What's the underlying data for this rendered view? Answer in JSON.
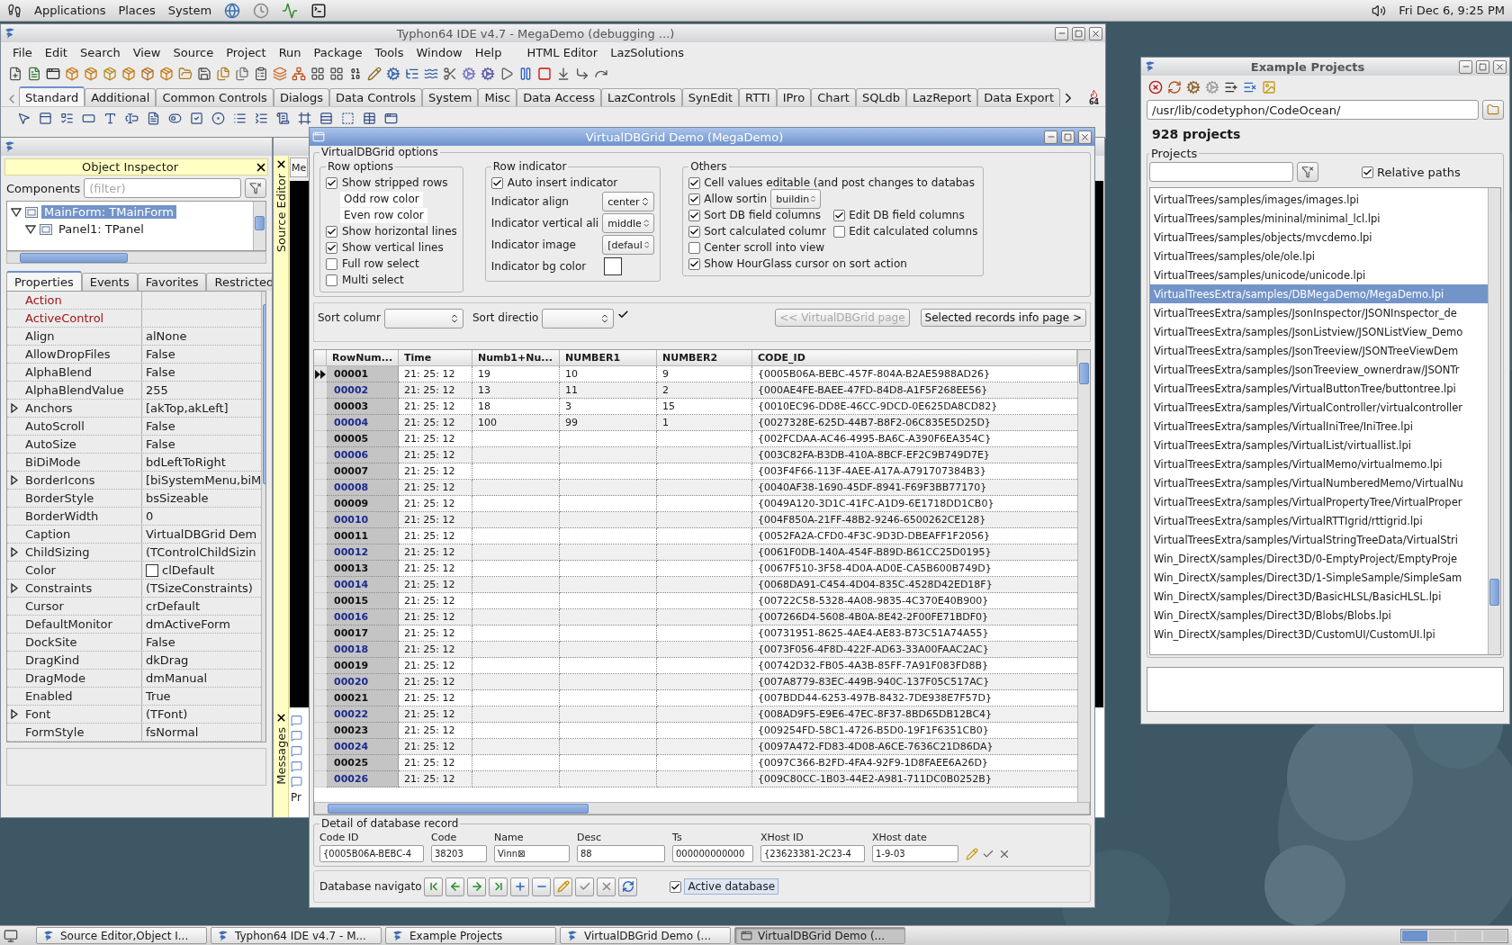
{
  "top_panel": {
    "menus": [
      "Applications",
      "Places",
      "System"
    ],
    "clock": "Fri Dec 6, 9:25 PM"
  },
  "ide": {
    "title": "Typhon64 IDE v4.7 - MegaDemo (debugging ...)",
    "menu": [
      "File",
      "Edit",
      "Search",
      "View",
      "Source",
      "Project",
      "Run",
      "Package",
      "Tools",
      "Window",
      "Help",
      "HTML Editor",
      "LazSolutions"
    ],
    "palette_tabs": [
      {
        "label": "Standard",
        "selected": true
      },
      {
        "label": "Additional",
        "selected": false
      },
      {
        "label": "Common Controls",
        "selected": false
      },
      {
        "label": "Dialogs",
        "selected": false
      },
      {
        "label": "Data Controls",
        "selected": false
      },
      {
        "label": "System",
        "selected": false
      },
      {
        "label": "Misc",
        "selected": false
      },
      {
        "label": "Data Access",
        "selected": false
      },
      {
        "label": "LazControls",
        "selected": false
      },
      {
        "label": "SynEdit",
        "selected": false
      },
      {
        "label": "RTTI",
        "selected": false
      },
      {
        "label": "IPro",
        "selected": false
      },
      {
        "label": "Chart",
        "selected": false
      },
      {
        "label": "SQLdb",
        "selected": false
      },
      {
        "label": "LazReport",
        "selected": false
      },
      {
        "label": "Data Export",
        "selected": false
      }
    ],
    "arch_badge": "64"
  },
  "object_inspector": {
    "title": "Object Inspector",
    "components_label": "Components",
    "filter_placeholder": "(filter)",
    "tree": [
      {
        "label": "MainForm: TMainForm",
        "selected": true,
        "expanded": true,
        "children": [
          {
            "label": "Panel1: TPanel",
            "selected": false,
            "expanded": true
          }
        ]
      }
    ],
    "tabs": [
      {
        "label": "Properties",
        "selected": true
      },
      {
        "label": "Events",
        "selected": false
      },
      {
        "label": "Favorites",
        "selected": false
      },
      {
        "label": "Restricted",
        "selected": false
      }
    ],
    "properties": [
      {
        "name": "Action",
        "kind": "reference",
        "expandable": false
      },
      {
        "name": "ActiveControl",
        "kind": "reference",
        "expandable": false
      },
      {
        "name": "Align",
        "value": "alNone",
        "kind": "plain",
        "expandable": false
      },
      {
        "name": "AllowDropFiles",
        "value": "False",
        "kind": "plain",
        "expandable": false
      },
      {
        "name": "AlphaBlend",
        "value": "False",
        "kind": "plain",
        "expandable": false
      },
      {
        "name": "AlphaBlendValue",
        "value": "255",
        "kind": "plain",
        "expandable": false
      },
      {
        "name": "Anchors",
        "value": "[akTop,akLeft]",
        "kind": "plain",
        "expandable": true
      },
      {
        "name": "AutoScroll",
        "value": "False",
        "kind": "plain",
        "expandable": false
      },
      {
        "name": "AutoSize",
        "value": "False",
        "kind": "plain",
        "expandable": false
      },
      {
        "name": "BiDiMode",
        "value": "bdLeftToRight",
        "kind": "plain",
        "expandable": false
      },
      {
        "name": "BorderIcons",
        "value": "[biSystemMenu,biM",
        "kind": "plain",
        "expandable": true
      },
      {
        "name": "BorderStyle",
        "value": "bsSizeable",
        "kind": "plain",
        "expandable": false
      },
      {
        "name": "BorderWidth",
        "value": "0",
        "kind": "plain",
        "expandable": false
      },
      {
        "name": "Caption",
        "value": "VirtualDBGrid Dem",
        "kind": "plain",
        "expandable": false
      },
      {
        "name": "ChildSizing",
        "value": "(TControlChildSizin",
        "kind": "plain",
        "expandable": true
      },
      {
        "name": "Color",
        "value": "clDefault",
        "kind": "color",
        "expandable": false
      },
      {
        "name": "Constraints",
        "value": "(TSizeConstraints)",
        "kind": "plain",
        "expandable": true
      },
      {
        "name": "Cursor",
        "value": "crDefault",
        "kind": "plain",
        "expandable": false
      },
      {
        "name": "DefaultMonitor",
        "value": "dmActiveForm",
        "kind": "plain",
        "expandable": false
      },
      {
        "name": "DockSite",
        "value": "False",
        "kind": "plain",
        "expandable": false
      },
      {
        "name": "DragKind",
        "value": "dkDrag",
        "kind": "plain",
        "expandable": false
      },
      {
        "name": "DragMode",
        "value": "dmManual",
        "kind": "plain",
        "expandable": false
      },
      {
        "name": "Enabled",
        "value": "True",
        "kind": "plain",
        "expandable": false
      },
      {
        "name": "Font",
        "value": "(TFont)",
        "kind": "plain",
        "expandable": true
      },
      {
        "name": "FormStyle",
        "value": "fsNormal",
        "kind": "plain",
        "expandable": false
      }
    ]
  },
  "source_editor": {
    "side_title": "Source Editor",
    "page_tab": "Me",
    "messages_title": "Messages",
    "message_text": "Pr"
  },
  "grid_demo": {
    "title": "VirtualDBGrid Demo (MegaDemo)",
    "options_title": "VirtualDBGrid options",
    "row_options": {
      "title": "Row options",
      "items": [
        {
          "kind": "check",
          "label": "Show stripped rows",
          "checked": true
        },
        {
          "kind": "color",
          "label": "Odd row color"
        },
        {
          "kind": "color",
          "label": "Even row color"
        },
        {
          "kind": "check",
          "label": "Show horizontal lines",
          "checked": true
        },
        {
          "kind": "check",
          "label": "Show vertical lines",
          "checked": true
        },
        {
          "kind": "check",
          "label": "Full row select",
          "checked": false
        },
        {
          "kind": "check",
          "label": "Multi select",
          "checked": false
        }
      ]
    },
    "row_indicator": {
      "title": "Row indicator",
      "auto_insert": {
        "label": "Auto insert indicator",
        "checked": true
      },
      "fields": [
        {
          "kind": "select",
          "label": "Indicator align",
          "value": "center"
        },
        {
          "kind": "select",
          "label": "Indicator vertical ali",
          "value": "middle"
        },
        {
          "kind": "select",
          "label": "Indicator image",
          "value": "[defaul"
        },
        {
          "kind": "color",
          "label": "Indicator bg color"
        }
      ]
    },
    "others": {
      "title": "Others",
      "rows": [
        {
          "items": [
            {
              "label": "Cell values editable (and post changes to databas",
              "checked": true
            }
          ]
        },
        {
          "items": [
            {
              "label": "Allow sortin",
              "checked": true,
              "select": "buildin"
            }
          ]
        },
        {
          "items": [
            {
              "label": "Sort DB field columns",
              "checked": true
            },
            {
              "label": "Edit DB field columns",
              "checked": true
            }
          ]
        },
        {
          "items": [
            {
              "label": "Sort calculated columr",
              "checked": true
            },
            {
              "label": "Edit calculated columns",
              "checked": false
            }
          ]
        },
        {
          "items": [
            {
              "label": "Center scroll into view",
              "checked": false
            }
          ]
        },
        {
          "items": [
            {
              "label": "Show HourGlass cursor on sort action",
              "checked": true
            }
          ]
        }
      ]
    },
    "sort": {
      "column_label": "Sort columr",
      "direction_label": "Sort directio",
      "prev_button": {
        "label": "<< VirtualDBGrid page",
        "disabled": true
      },
      "next_button": {
        "label": "Selected records info page >",
        "disabled": false
      }
    },
    "grid": {
      "columns": [
        "RowNum...",
        "Time",
        "Numb1+Nu...",
        "NUMBER1",
        "NUMBER2",
        "CODE_ID"
      ],
      "rows": [
        {
          "row_num": "00001",
          "time": "21: 25: 12",
          "sum": "19",
          "number1": "10",
          "number2": "9",
          "code_id": "{0005B06A-BEBC-457F-804A-B2AE5988AD26}",
          "current": true
        },
        {
          "row_num": "00002",
          "time": "21: 25: 12",
          "sum": "13",
          "number1": "11",
          "number2": "2",
          "code_id": "{000AE4FE-BAEE-47FD-84D8-A1F5F268EE56}",
          "current": false
        },
        {
          "row_num": "00003",
          "time": "21: 25: 12",
          "sum": "18",
          "number1": "3",
          "number2": "15",
          "code_id": "{0010EC96-DD8E-46CC-9DCD-0E625DA8CD82}",
          "current": false
        },
        {
          "row_num": "00004",
          "time": "21: 25: 12",
          "sum": "100",
          "number1": "99",
          "number2": "1",
          "code_id": "{0027328E-625D-44B7-B8F2-06C835E5D25D}",
          "current": false
        },
        {
          "row_num": "00005",
          "time": "21: 25: 12",
          "code_id": "{002FCDAA-AC46-4995-BA6C-A390F6EA354C}",
          "current": false
        },
        {
          "row_num": "00006",
          "time": "21: 25: 12",
          "code_id": "{003C82FA-B3DB-410A-8BCF-EF2C9B749D7E}",
          "current": false
        },
        {
          "row_num": "00007",
          "time": "21: 25: 12",
          "code_id": "{003F4F66-113F-4AEE-A17A-A791707384B3}",
          "current": false
        },
        {
          "row_num": "00008",
          "time": "21: 25: 12",
          "code_id": "{0040AF38-1690-45DF-8941-F69F3BB77170}",
          "current": false
        },
        {
          "row_num": "00009",
          "time": "21: 25: 12",
          "code_id": "{0049A120-3D1C-41FC-A1D9-6E1718DD1CB0}",
          "current": false
        },
        {
          "row_num": "00010",
          "time": "21: 25: 12",
          "code_id": "{004F850A-21FF-48B2-9246-6500262CE128}",
          "current": false
        },
        {
          "row_num": "00011",
          "time": "21: 25: 12",
          "code_id": "{0052FA2A-CFD0-4F3C-9D3D-DBEAFF1F2056}",
          "current": false
        },
        {
          "row_num": "00012",
          "time": "21: 25: 12",
          "code_id": "{0061F0DB-140A-454F-B89D-B61CC25D0195}",
          "current": false
        },
        {
          "row_num": "00013",
          "time": "21: 25: 12",
          "code_id": "{0067F510-3F58-4D0A-AD0E-CA5B600B749D}",
          "current": false
        },
        {
          "row_num": "00014",
          "time": "21: 25: 12",
          "code_id": "{0068DA91-C454-4D04-835C-4528D42ED18F}",
          "current": false
        },
        {
          "row_num": "00015",
          "time": "21: 25: 12",
          "code_id": "{00722C58-5328-4A08-9835-4C370E40B900}",
          "current": false
        },
        {
          "row_num": "00016",
          "time": "21: 25: 12",
          "code_id": "{007266D4-5608-4B0A-8E42-2F00FE71BDF0}",
          "current": false
        },
        {
          "row_num": "00017",
          "time": "21: 25: 12",
          "code_id": "{00731951-8625-4AE4-AE83-B73C51A74A55}",
          "current": false
        },
        {
          "row_num": "00018",
          "time": "21: 25: 12",
          "code_id": "{0073F056-4F8D-422F-AD63-33A00FAAC2AC}",
          "current": false
        },
        {
          "row_num": "00019",
          "time": "21: 25: 12",
          "code_id": "{00742D32-FB05-4A3B-85FF-7A91F083FD8B}",
          "current": false
        },
        {
          "row_num": "00020",
          "time": "21: 25: 12",
          "code_id": "{007A8779-83EC-449B-940C-137F05C517AC}",
          "current": false
        },
        {
          "row_num": "00021",
          "time": "21: 25: 12",
          "code_id": "{007BDD44-6253-497B-8432-7DE938E7F57D}",
          "current": false
        },
        {
          "row_num": "00022",
          "time": "21: 25: 12",
          "code_id": "{008AD9F5-E9E6-47EC-8F37-8BD65DB12BC4}",
          "current": false
        },
        {
          "row_num": "00023",
          "time": "21: 25: 12",
          "code_id": "{009254FD-58C1-4726-B5D0-19F1F6351CB0}",
          "current": false
        },
        {
          "row_num": "00024",
          "time": "21: 25: 12",
          "code_id": "{0097A472-FD83-4D08-A6CE-7636C21D86DA}",
          "current": false
        },
        {
          "row_num": "00025",
          "time": "21: 25: 12",
          "code_id": "{0097C366-B2FD-4FA4-92F9-1D8FAEE6A26D}",
          "current": false
        },
        {
          "row_num": "00026",
          "time": "21: 25: 12",
          "code_id": "{009C80CC-1B03-44E2-A981-711DC0B0252B}",
          "current": false
        }
      ]
    },
    "detail": {
      "title": "Detail of database record",
      "fields": [
        {
          "label": "Code ID",
          "value": "{0005B06A-BEBC-4"
        },
        {
          "label": "Code",
          "value": "38203"
        },
        {
          "label": "Name",
          "value": "Vinn⊠"
        },
        {
          "label": "Desc",
          "value": "88"
        },
        {
          "label": "Ts",
          "value": "000000000000"
        },
        {
          "label": "XHost ID",
          "value": "{23623381-2C23-4"
        },
        {
          "label": "XHost date",
          "value": "1-9-03"
        }
      ]
    },
    "navigator": {
      "label": "Database navigato",
      "active": {
        "label": "Active database",
        "checked": true
      }
    }
  },
  "example_projects": {
    "title": "Example Projects",
    "path": "/usr/lib/codetyphon/CodeOcean/",
    "count": "928 projects",
    "projects_title": "Projects",
    "relative_paths": {
      "label": "Relative paths",
      "checked": true
    },
    "items": [
      {
        "label": "VirtualTrees/samples/images/images.lpi",
        "selected": false
      },
      {
        "label": "VirtualTrees/samples/mininal/minimal_lcl.lpi",
        "selected": false
      },
      {
        "label": "VirtualTrees/samples/objects/mvcdemo.lpi",
        "selected": false
      },
      {
        "label": "VirtualTrees/samples/ole/ole.lpi",
        "selected": false
      },
      {
        "label": "VirtualTrees/samples/unicode/unicode.lpi",
        "selected": false
      },
      {
        "label": "VirtualTreesExtra/samples/DBMegaDemo/MegaDemo.lpi",
        "selected": true
      },
      {
        "label": "VirtualTreesExtra/samples/JsonInspector/JSONInspector_de",
        "selected": false
      },
      {
        "label": "VirtualTreesExtra/samples/JsonListview/JSONListView_Demo",
        "selected": false
      },
      {
        "label": "VirtualTreesExtra/samples/JsonTreeview/JSONTreeViewDem",
        "selected": false
      },
      {
        "label": "VirtualTreesExtra/samples/JsonTreeview_ownerdraw/JSONTr",
        "selected": false
      },
      {
        "label": "VirtualTreesExtra/samples/VirtualButtonTree/buttontree.lpi",
        "selected": false
      },
      {
        "label": "VirtualTreesExtra/samples/VirtualController/virtualcontroller",
        "selected": false
      },
      {
        "label": "VirtualTreesExtra/samples/VirtualIniTree/IniTree.lpi",
        "selected": false
      },
      {
        "label": "VirtualTreesExtra/samples/VirtualList/virtuallist.lpi",
        "selected": false
      },
      {
        "label": "VirtualTreesExtra/samples/VirtualMemo/virtualmemo.lpi",
        "selected": false
      },
      {
        "label": "VirtualTreesExtra/samples/VirtualNumberedMemo/VirtualNu",
        "selected": false
      },
      {
        "label": "VirtualTreesExtra/samples/VirtualPropertyTree/VirtualProper",
        "selected": false
      },
      {
        "label": "VirtualTreesExtra/samples/VirtualRTTIgrid/rttigrid.lpi",
        "selected": false
      },
      {
        "label": "VirtualTreesExtra/samples/VirtualStringTreeData/VirtualStri",
        "selected": false
      },
      {
        "label": "Win_DirectX/samples/Direct3D/0-EmptyProject/EmptyProje",
        "selected": false
      },
      {
        "label": "Win_DirectX/samples/Direct3D/1-SimpleSample/SimpleSam",
        "selected": false
      },
      {
        "label": "Win_DirectX/samples/Direct3D/BasicHLSL/BasicHLSL.lpi",
        "selected": false
      },
      {
        "label": "Win_DirectX/samples/Direct3D/Blobs/Blobs.lpi",
        "selected": false
      },
      {
        "label": "Win_DirectX/samples/Direct3D/CustomUI/CustomUI.lpi",
        "selected": false
      }
    ]
  },
  "taskbar": {
    "items": [
      {
        "label": "Source Editor,Object I...",
        "selected": false
      },
      {
        "label": "Typhon64 IDE v4.7 - M...",
        "selected": false
      },
      {
        "label": "Example Projects",
        "selected": false
      },
      {
        "label": "VirtualDBGrid Demo (...",
        "selected": false
      },
      {
        "label": "VirtualDBGrid Demo (...",
        "selected": true
      }
    ]
  }
}
